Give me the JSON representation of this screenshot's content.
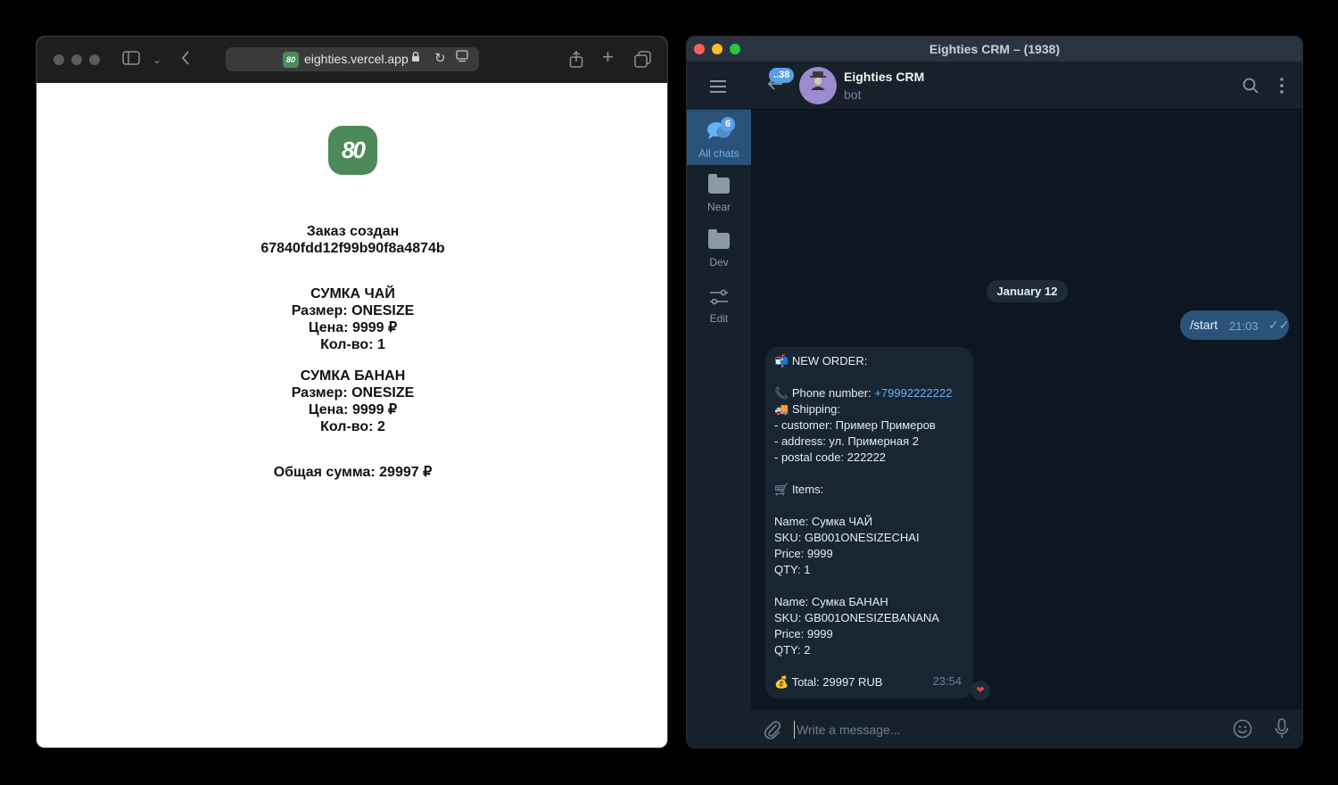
{
  "safari": {
    "url": "eighties.vercel.app",
    "favicon_text": "80",
    "icons": [
      "sidebar-icon",
      "chevron-down-icon",
      "back-icon",
      "lock-icon",
      "reload-icon",
      "reader-icon",
      "share-icon",
      "new-tab-icon",
      "tabs-icon"
    ]
  },
  "page": {
    "logo_text": "80",
    "order_title": "Заказ создан",
    "order_id": "67840fdd12f99b90f8a4874b",
    "items": [
      {
        "name": "СУМКА ЧАЙ",
        "size": "Размер: ONESIZE",
        "price": "Цена: 9999 ₽",
        "qty": "Кол-во: 1"
      },
      {
        "name": "СУМКА БАНАН",
        "size": "Размер: ONESIZE",
        "price": "Цена: 9999 ₽",
        "qty": "Кол-во: 2"
      }
    ],
    "total": "Общая сумма: 29997 ₽"
  },
  "telegram": {
    "window_title": "Eighties CRM – (1938)",
    "rail": [
      {
        "label": "All chats",
        "badge": "6"
      },
      {
        "label": "Near"
      },
      {
        "label": "Dev"
      },
      {
        "label": "Edit"
      }
    ],
    "header": {
      "back_badge": "..38",
      "name": "Eighties CRM",
      "status": "bot"
    },
    "date": "January 12",
    "outgoing": {
      "text": "/start",
      "time": "21:03",
      "ticks": "✓✓"
    },
    "incoming": {
      "lines": [
        {
          "emoji": "📬",
          "text": "NEW ORDER:"
        },
        {
          "text": ""
        },
        {
          "emoji": "📞",
          "text": "Phone number: ",
          "link": "+79992222222"
        },
        {
          "emoji": "🚚",
          "text": "Shipping:"
        },
        {
          "text": " - customer: Пример Примеров"
        },
        {
          "text": " - address: ул. Примерная 2"
        },
        {
          "text": " - postal code: 222222"
        },
        {
          "text": ""
        },
        {
          "emoji": "🛒",
          "text": "Items:"
        },
        {
          "text": ""
        },
        {
          "text": "Name: Сумка ЧАЙ"
        },
        {
          "text": "SKU: GB001ONESIZECHAI"
        },
        {
          "text": "Price: 9999"
        },
        {
          "text": "QTY: 1"
        },
        {
          "text": ""
        },
        {
          "text": "Name: Сумка БАНАН"
        },
        {
          "text": "SKU: GB001ONESIZEBANANA"
        },
        {
          "text": "Price: 9999"
        },
        {
          "text": "QTY: 2"
        },
        {
          "text": ""
        },
        {
          "emoji": "💰",
          "text": "Total: 29997 RUB"
        }
      ],
      "time": "23:54",
      "reaction": "❤"
    },
    "composer_placeholder": "Write a message..."
  }
}
